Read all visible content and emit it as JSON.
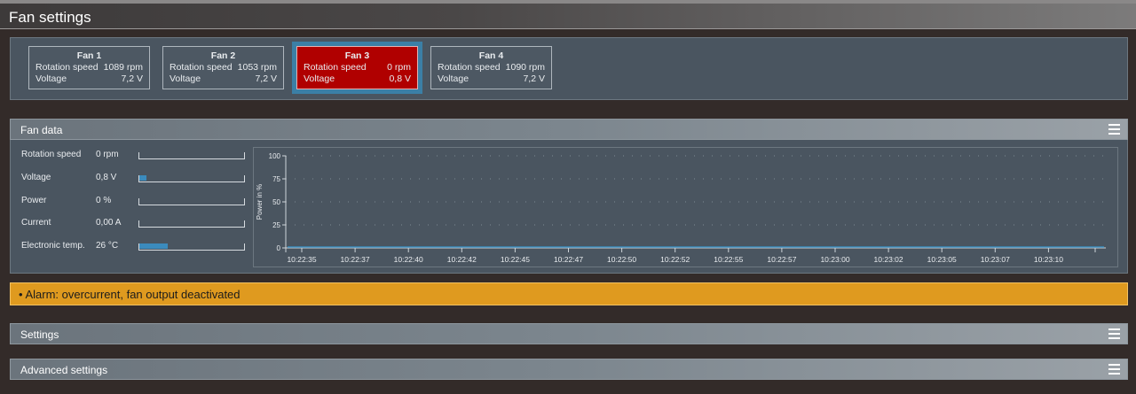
{
  "window": {
    "title": "Fan settings"
  },
  "fans": [
    {
      "name": "Fan 1",
      "speed_label": "Rotation speed",
      "speed": "1089 rpm",
      "voltage_label": "Voltage",
      "voltage": "7,2 V",
      "selected": false
    },
    {
      "name": "Fan 2",
      "speed_label": "Rotation speed",
      "speed": "1053 rpm",
      "voltage_label": "Voltage",
      "voltage": "7,2 V",
      "selected": false
    },
    {
      "name": "Fan 3",
      "speed_label": "Rotation speed",
      "speed": "0 rpm",
      "voltage_label": "Voltage",
      "voltage": "0,8 V",
      "selected": true
    },
    {
      "name": "Fan 4",
      "speed_label": "Rotation speed",
      "speed": "1090 rpm",
      "voltage_label": "Voltage",
      "voltage": "7,2 V",
      "selected": false
    }
  ],
  "sections": {
    "fan_data": "Fan data",
    "settings": "Settings",
    "advanced": "Advanced settings"
  },
  "metrics": [
    {
      "label": "Rotation speed",
      "value": "0 rpm",
      "level": 0
    },
    {
      "label": "Voltage",
      "value": "0,8 V",
      "level": 0.07
    },
    {
      "label": "Power",
      "value": "0 %",
      "level": 0
    },
    {
      "label": "Current",
      "value": "0,00 A",
      "level": 0
    },
    {
      "label": "Electronic temp.",
      "value": "26 °C",
      "level": 0.27
    }
  ],
  "alarm": {
    "text": "• Alarm: overcurrent, fan output deactivated"
  },
  "icons": {
    "menu": "hamburger-menu-icon"
  },
  "colors": {
    "selected_fan": "#b00000",
    "alarm": "#df9a1f",
    "series": "#3b8bbd"
  },
  "chart_data": {
    "type": "line",
    "ylabel": "Power in %",
    "ylim": [
      0,
      100
    ],
    "yticks": [
      0,
      25,
      50,
      75,
      100
    ],
    "x": [
      "10:22:35",
      "10:22:37",
      "10:22:40",
      "10:22:42",
      "10:22:45",
      "10:22:47",
      "10:22:50",
      "10:22:52",
      "10:22:55",
      "10:22:57",
      "10:23:00",
      "10:23:02",
      "10:23:05",
      "10:23:07",
      "10:23:10"
    ],
    "series": [
      {
        "values": [
          0,
          0,
          0,
          0,
          0,
          0,
          0,
          0,
          0,
          0,
          0,
          0,
          0,
          0,
          0
        ]
      }
    ],
    "grid": true
  }
}
